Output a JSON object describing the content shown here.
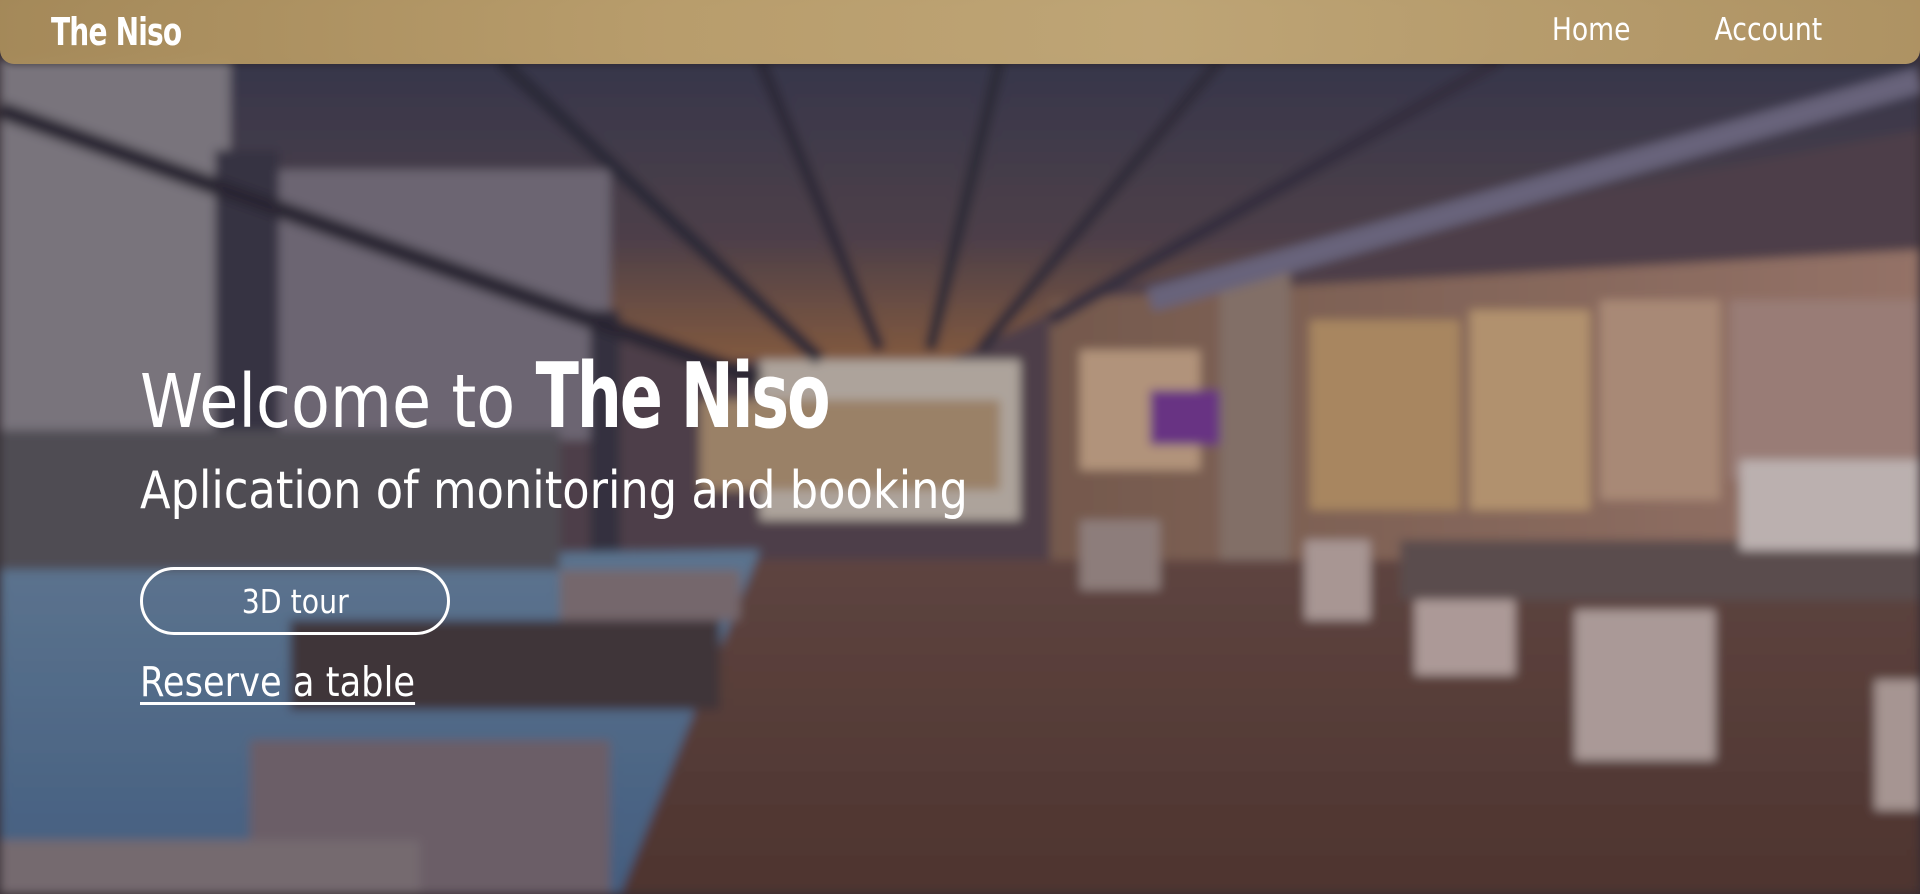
{
  "navbar": {
    "brand": "The Niso",
    "links": [
      {
        "label": "Home"
      },
      {
        "label": "Account"
      }
    ]
  },
  "hero": {
    "welcome_prefix": "Welcome to",
    "welcome_brand": "The Niso",
    "subtitle": "Aplication of monitoring and booking",
    "tour_button": "3D tour",
    "reserve_link": "Reserve a table"
  },
  "colors": {
    "navbar_bg": "#b89c6a",
    "text": "#ffffff",
    "floor": "#6a4a40"
  }
}
